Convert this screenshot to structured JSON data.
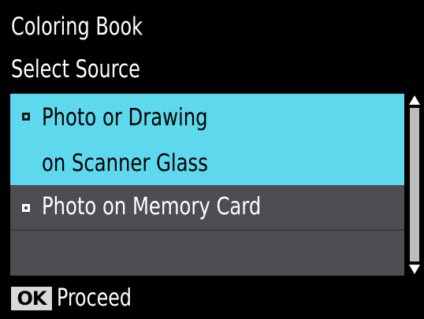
{
  "header": {
    "title": "Coloring Book",
    "subtitle": "Select Source"
  },
  "source_list": {
    "items": [
      {
        "line1": "Photo or Drawing",
        "line2": "on Scanner Glass",
        "selected": true
      },
      {
        "line1": "Photo on Memory Card",
        "selected": false
      }
    ]
  },
  "scrollbar": {
    "up_icon": "triangle-up-icon",
    "down_icon": "triangle-down-icon"
  },
  "footer": {
    "ok_key": "OK",
    "action_label": "Proceed"
  },
  "colors": {
    "background": "#000000",
    "selected_item": "#5ed8ec",
    "list_background": "#4d4d52",
    "scroll_track": "#bcbcbc",
    "ok_key_background": "#d9d9d9"
  }
}
